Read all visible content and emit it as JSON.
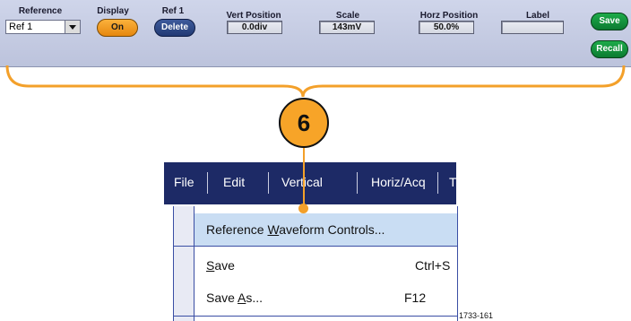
{
  "control_bar": {
    "reference_label": "Reference",
    "reference_value": "Ref 1",
    "display_label": "Display",
    "display_button": "On",
    "ref1_label": "Ref 1",
    "delete_button": "Delete",
    "vert_position_label": "Vert Position",
    "vert_position_value": "0.0div",
    "scale_label": "Scale",
    "scale_value": "143mV",
    "horz_position_label": "Horz Position",
    "horz_position_value": "50.0%",
    "label_label": "Label",
    "label_value": "",
    "save_button": "Save",
    "recall_button": "Recall"
  },
  "callout": {
    "number": "6",
    "color": "#f7a428"
  },
  "menubar": {
    "items": [
      "File",
      "Edit",
      "Vertical",
      "Horiz/Acq",
      "T"
    ],
    "background": "#1d2a66"
  },
  "dropdown": {
    "items": [
      {
        "pre": "Reference ",
        "accel": "W",
        "post": "aveform Controls...",
        "shortcut": "",
        "highlighted": true
      },
      {
        "pre": "",
        "accel": "S",
        "post": "ave",
        "shortcut": "Ctrl+S",
        "highlighted": false
      },
      {
        "pre": "Save ",
        "accel": "A",
        "post": "s...",
        "shortcut": "F12",
        "highlighted": false,
        "submenu": true
      }
    ]
  },
  "figure_id": "1733-161"
}
